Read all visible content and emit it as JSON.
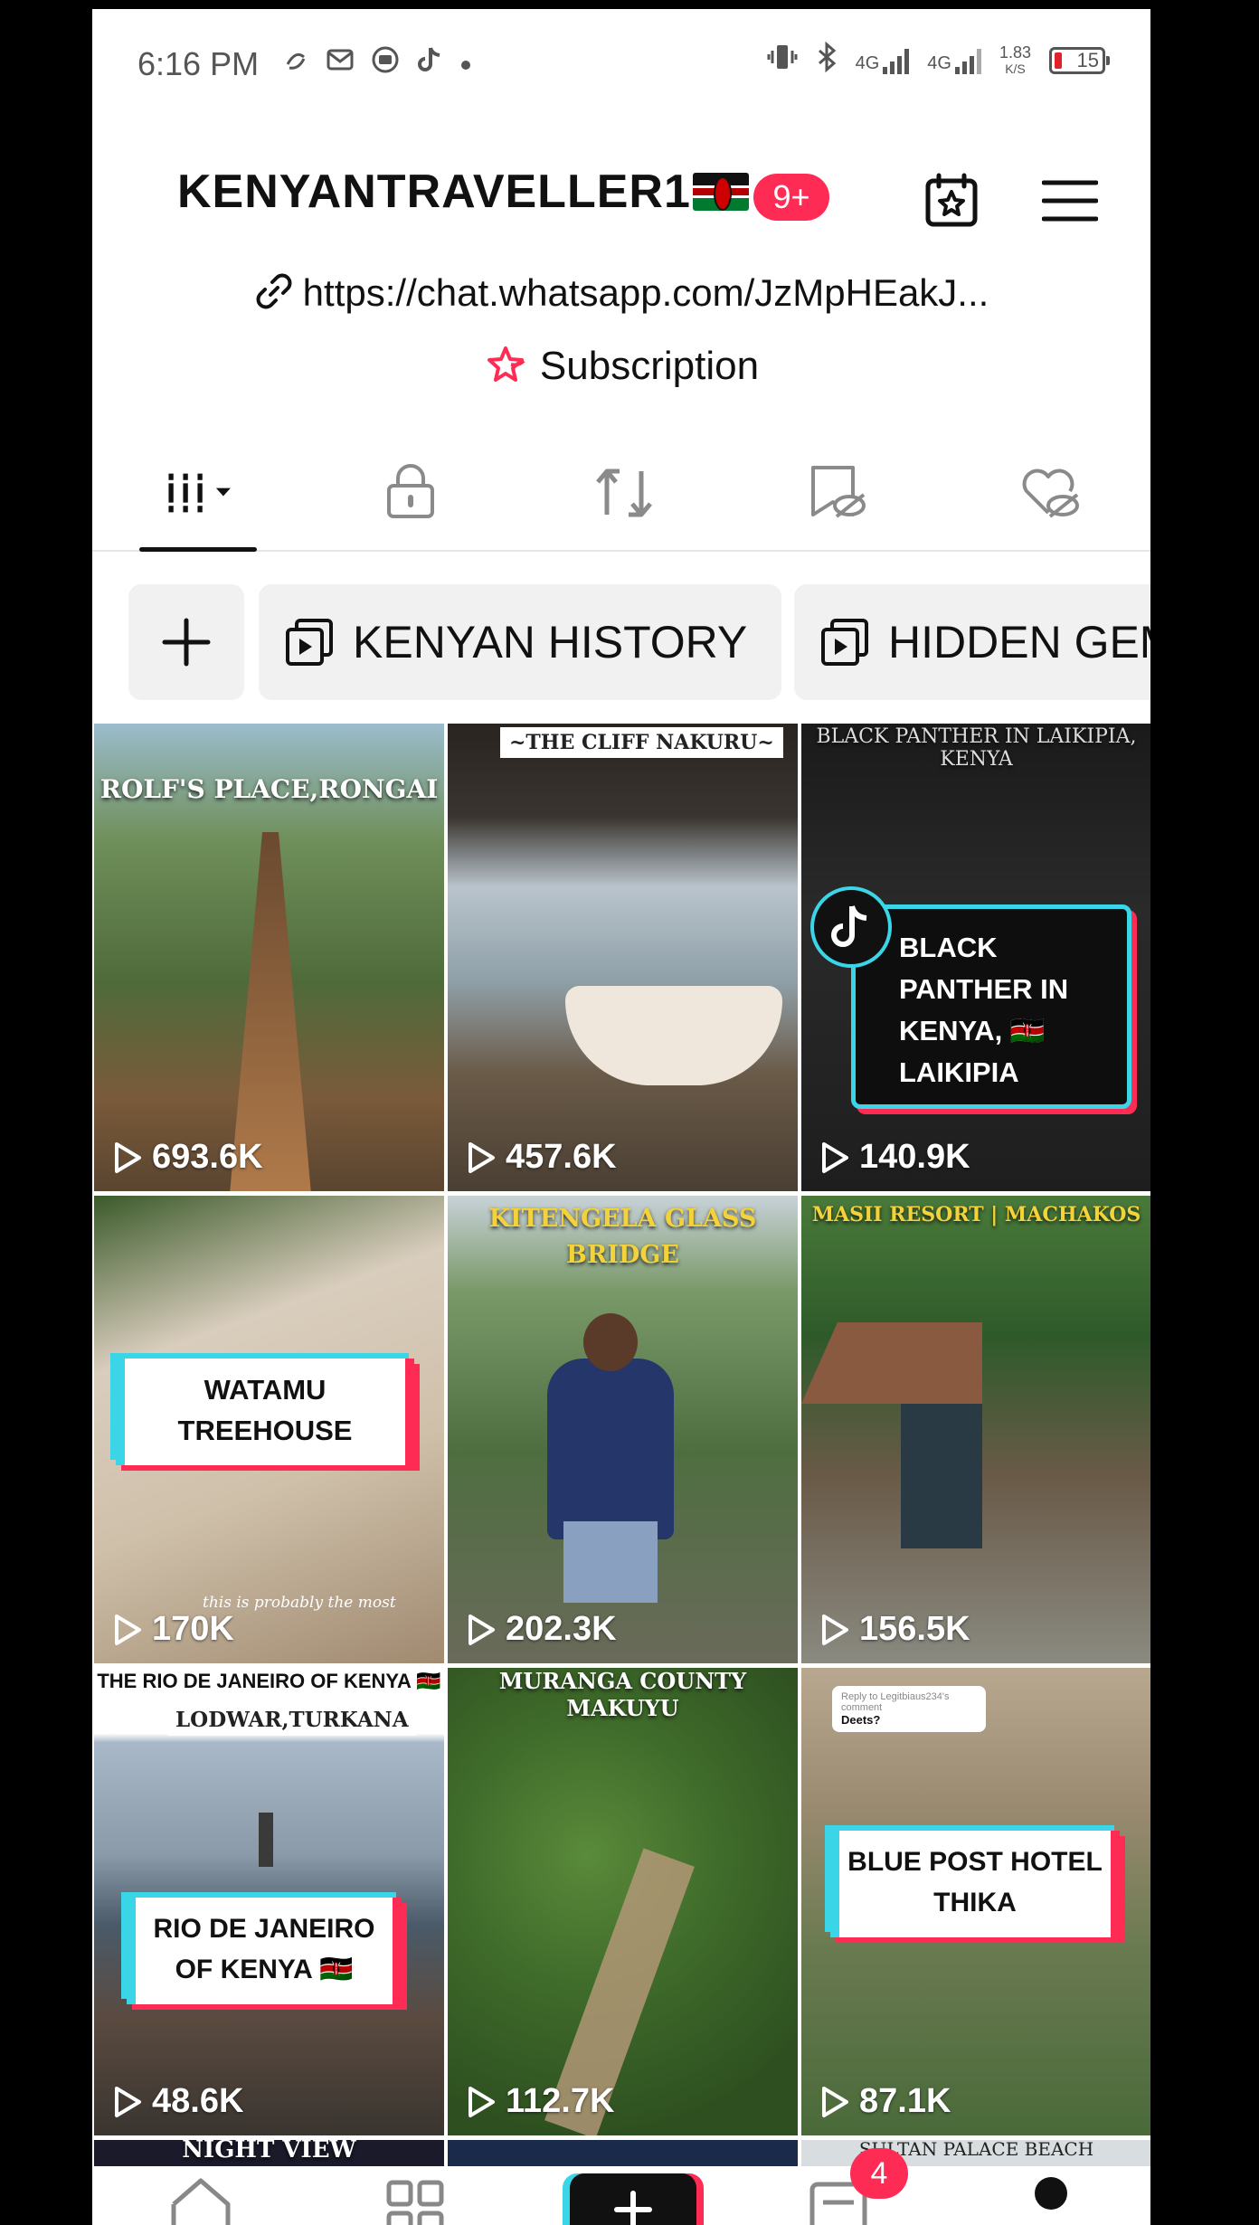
{
  "status_bar": {
    "time": "6:16 PM",
    "net_speed_value": "1.83",
    "net_speed_unit": "K/S",
    "battery_level": "15",
    "network_1": "4G",
    "network_2": "4G"
  },
  "header": {
    "username": "KENYANTRAVELLER1",
    "notification_count": "9+"
  },
  "profile": {
    "link": "https://chat.whatsapp.com/JzMpHEakJ...",
    "subscription_label": "Subscription"
  },
  "tabs": [
    "videos",
    "private",
    "reposts",
    "favorites",
    "liked"
  ],
  "collections": {
    "items": [
      "KENYAN HISTORY",
      "HIDDEN GEM"
    ]
  },
  "videos": [
    {
      "caption": "ROLF'S PLACE,RONGAI",
      "views": "693.6K"
    },
    {
      "caption": "~THE CLIFF NAKURU~",
      "views": "457.6K"
    },
    {
      "caption_top": "BLACK PANTHER IN LAIKIPIA, KENYA",
      "caption_card": "BLACK PANTHER IN KENYA, 🇰🇪 LAIKIPIA",
      "views": "140.9K"
    },
    {
      "caption_card": "WATAMU TREEHOUSE",
      "subtitle": "this is probably the most",
      "views": "170K"
    },
    {
      "caption": "KITENGELA GLASS BRIDGE",
      "views": "202.3K"
    },
    {
      "caption": "MASII RESORT | MACHAKOS",
      "views": "156.5K"
    },
    {
      "caption_top": "THE RIO DE JANEIRO OF KENYA 🇰🇪",
      "caption_sub": "LODWAR,TURKANA",
      "caption_card": "RIO DE JANEIRO OF KENYA 🇰🇪",
      "views": "48.6K"
    },
    {
      "caption": "MURANGA COUNTY MAKUYU",
      "views": "112.7K"
    },
    {
      "reply_text": "Reply to Legitbiaus234's comment",
      "reply_comment": "Deets?",
      "caption_card": "BLUE POST HOTEL THIKA",
      "views": "87.1K"
    }
  ],
  "next_row_captions": [
    "NIGHT VIEW",
    "",
    "SULTAN PALACE BEACH"
  ],
  "bottom_nav": {
    "inbox_badge": "4"
  },
  "colors": {
    "accent_red": "#fe2c55",
    "accent_cyan": "#3ad6e8"
  }
}
